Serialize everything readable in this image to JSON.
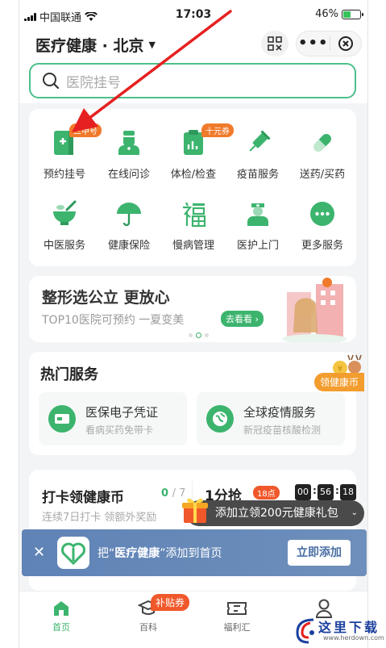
{
  "status_bar": {
    "carrier": "中国联通",
    "time": "17:03",
    "battery": "46%"
  },
  "header": {
    "title": "医疗健康 · 北京",
    "more_label": "•••"
  },
  "search": {
    "placeholder": "医院挂号"
  },
  "services": [
    {
      "label": "预约挂号",
      "icon": "register-icon",
      "tag": "三甲号"
    },
    {
      "label": "在线问诊",
      "icon": "doctor-icon"
    },
    {
      "label": "体检/检查",
      "icon": "checkup-icon",
      "tag": "十元券"
    },
    {
      "label": "疫苗服务",
      "icon": "vaccine-icon"
    },
    {
      "label": "送药/买药",
      "icon": "pill-icon"
    },
    {
      "label": "中医服务",
      "icon": "tcm-icon"
    },
    {
      "label": "健康保险",
      "icon": "umbrella-icon"
    },
    {
      "label": "慢病管理",
      "icon": "fu-icon"
    },
    {
      "label": "医护上门",
      "icon": "nurse-icon"
    },
    {
      "label": "更多服务",
      "icon": "more-icon"
    }
  ],
  "banner": {
    "title": "整形选公立 更放心",
    "subtitle": "TOP10医院可预约 一夏变美",
    "button": "去看看"
  },
  "hot": {
    "title": "热门服务",
    "items": [
      {
        "title": "医保电子凭证",
        "subtitle": "看病买药免带卡"
      },
      {
        "title": "全球疫情服务",
        "subtitle": "新冠疫苗核酸检测"
      }
    ],
    "coin_badge": "领健康币"
  },
  "checkin": {
    "title": "打卡领健康币",
    "count": "0",
    "total": "/ 7",
    "subtitle": "连续7日打卡 领额外奖励"
  },
  "flash": {
    "title": "1分抢",
    "tag": "18点",
    "hh": "00",
    "mm": "56",
    "ss": "18"
  },
  "gift_tip": "添加立领200元健康礼包",
  "add_bar": {
    "prefix": "把“",
    "name": "医疗健康",
    "suffix": "”添加到首页",
    "button": "立即添加"
  },
  "tabs": [
    {
      "label": "首页",
      "icon": "home-icon",
      "active": true
    },
    {
      "label": "百科",
      "icon": "encyclopedia-icon"
    },
    {
      "label": "福利汇",
      "icon": "ticket-icon"
    },
    {
      "label": "",
      "icon": "profile-icon"
    }
  ],
  "tab_badge": "补贴券",
  "watermark": {
    "main": "这里下载",
    "url": "www.herdown.com"
  },
  "colors": {
    "accent": "#3cb46e",
    "tag": "#f07a2b",
    "arrow": "#e62020"
  }
}
